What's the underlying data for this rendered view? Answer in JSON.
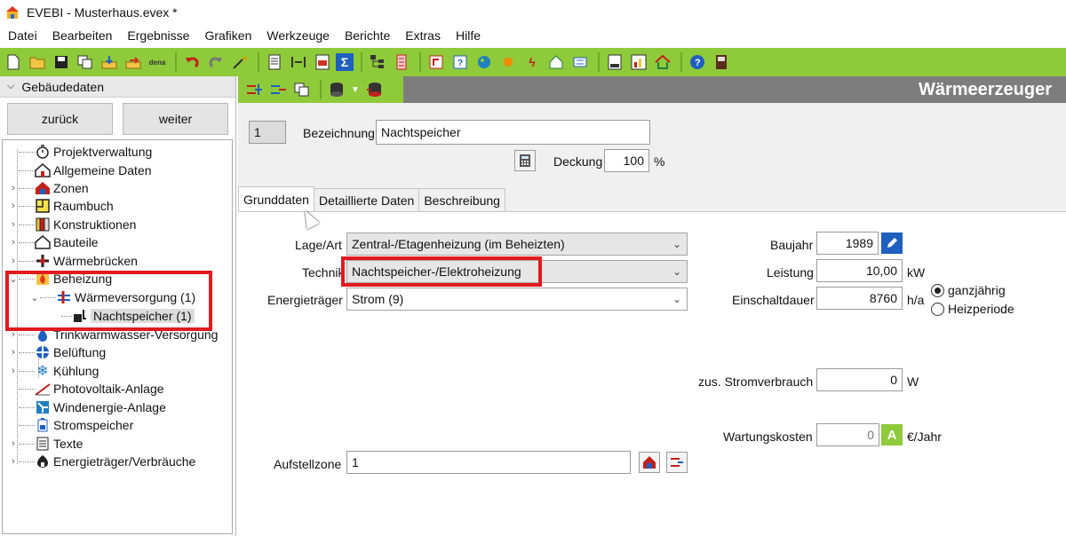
{
  "window": {
    "title": "EVEBI - Musterhaus.evex *"
  },
  "menu": [
    "Datei",
    "Bearbeiten",
    "Ergebnisse",
    "Grafiken",
    "Werkzeuge",
    "Berichte",
    "Extras",
    "Hilfe"
  ],
  "toolbar": {
    "dena_label": "dena"
  },
  "left_panel": {
    "header": "Gebäudedaten",
    "back_button": "zurück",
    "next_button": "weiter",
    "tree": [
      "Projektverwaltung",
      "Allgemeine Daten",
      "Zonen",
      "Raumbuch",
      "Konstruktionen",
      "Bauteile",
      "Wärmebrücken",
      "Beheizung",
      "Wärmeversorgung (1)",
      "Nachtspeicher (1)",
      "Trinkwarmwasser-Versorgung",
      "Belüftung",
      "Kühlung",
      "Photovoltaik-Anlage",
      "Windenergie-Anlage",
      "Stromspeicher",
      "Texte",
      "Energieträger/Verbräuche"
    ]
  },
  "main": {
    "section_title": "Wärmeerzeuger",
    "index_value": "1",
    "bezeichnung_label": "Bezeichnung",
    "bezeichnung_value": "Nachtspeicher",
    "deckung_label": "Deckung",
    "deckung_value": "100",
    "deckung_unit": "%",
    "tabs": [
      "Grunddaten",
      "Detaillierte Daten",
      "Beschreibung"
    ],
    "lage_label": "Lage/Art",
    "lage_value": "Zentral-/Etagenheizung (im Beheizten)",
    "technik_label": "Technik",
    "technik_value": "Nachtspeicher-/Elektroheizung",
    "energietraeger_label": "Energieträger",
    "energietraeger_value": "Strom (9)",
    "baujahr_label": "Baujahr",
    "baujahr_value": "1989",
    "leistung_label": "Leistung",
    "leistung_value": "10,00",
    "leistung_unit": "kW",
    "einschaltdauer_label": "Einschaltdauer",
    "einschaltdauer_value": "8760",
    "einschaltdauer_unit": "h/a",
    "radio_ganzjaehrig": "ganzjährig",
    "radio_heizperiode": "Heizperiode",
    "stromverbrauch_label": "zus. Stromverbrauch",
    "stromverbrauch_value": "0",
    "stromverbrauch_unit": "W",
    "wartung_label": "Wartungskosten",
    "wartung_value": "0",
    "wartung_unit": "€/Jahr",
    "wartung_auto_label": "A",
    "aufstellzone_label": "Aufstellzone",
    "aufstellzone_value": "1"
  },
  "colors": {
    "toolbar_green": "#8fca3a",
    "header_gray": "#7d7d7d",
    "highlight_red": "#e2191d"
  }
}
